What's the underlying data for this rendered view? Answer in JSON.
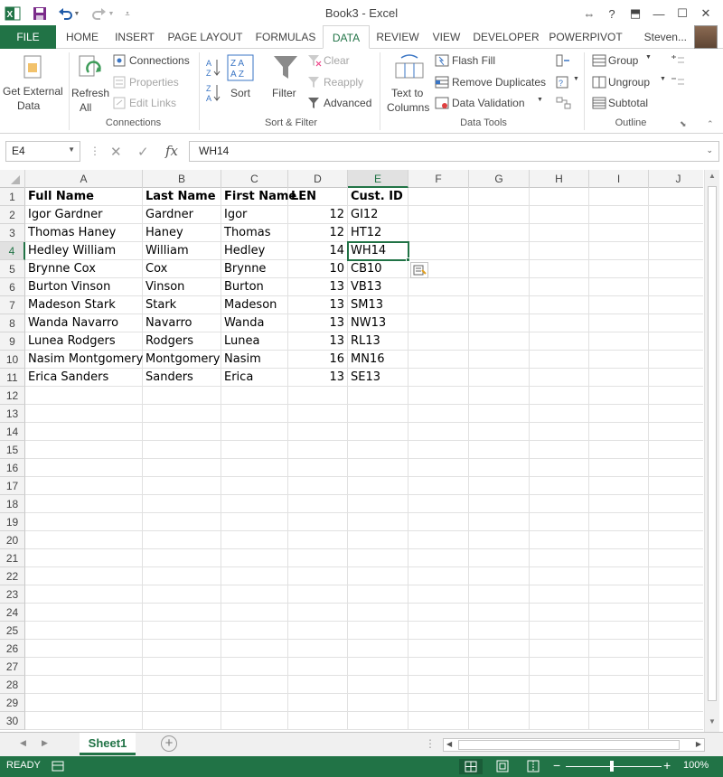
{
  "window": {
    "title": "Book3 - Excel",
    "help": "?",
    "restore_ribbon": "⬒",
    "minimize": "—",
    "maximize": "☐",
    "close": "✕"
  },
  "quick_access": {
    "more": "⇔"
  },
  "tabs": {
    "file": "FILE",
    "home": "HOME",
    "insert": "INSERT",
    "page_layout": "PAGE LAYOUT",
    "formulas": "FORMULAS",
    "data": "DATA",
    "review": "REVIEW",
    "view": "VIEW",
    "developer": "DEVELOPER",
    "powerpivot": "POWERPIVOT",
    "user": "Steven..."
  },
  "ribbon": {
    "get_external_1": "Get External",
    "get_external_2": "Data",
    "refresh_1": "Refresh",
    "refresh_2": "All",
    "connections": "Connections",
    "properties": "Properties",
    "edit_links": "Edit Links",
    "group_connections": "Connections",
    "sort": "Sort",
    "filter": "Filter",
    "clear": "Clear",
    "reapply": "Reapply",
    "advanced": "Advanced",
    "group_sort_filter": "Sort & Filter",
    "text_to_1": "Text to",
    "text_to_2": "Columns",
    "flash_fill": "Flash Fill",
    "remove_duplicates": "Remove Duplicates",
    "data_validation": "Data Validation",
    "group_data_tools": "Data Tools",
    "group": "Group",
    "ungroup": "Ungroup",
    "subtotal": "Subtotal",
    "group_outline": "Outline"
  },
  "formula_bar": {
    "name_box": "E4",
    "cancel": "✕",
    "enter": "✓",
    "fx": "fx",
    "value": "WH14"
  },
  "columns": [
    "A",
    "B",
    "C",
    "D",
    "E",
    "F",
    "G",
    "H",
    "I",
    "J"
  ],
  "selected_cell": "E4",
  "rows": [
    {
      "n": "1",
      "a": "Full Name",
      "b": "Last Name",
      "c": "First Name",
      "d": "LEN",
      "e": "Cust. ID"
    },
    {
      "n": "2",
      "a": "Igor Gardner",
      "b": "Gardner",
      "c": "Igor",
      "d": "12",
      "e": "GI12"
    },
    {
      "n": "3",
      "a": "Thomas Haney",
      "b": "Haney",
      "c": "Thomas",
      "d": "12",
      "e": "HT12"
    },
    {
      "n": "4",
      "a": "Hedley William",
      "b": "William",
      "c": "Hedley",
      "d": "14",
      "e": "WH14"
    },
    {
      "n": "5",
      "a": "Brynne Cox",
      "b": "Cox",
      "c": "Brynne",
      "d": "10",
      "e": "CB10"
    },
    {
      "n": "6",
      "a": "Burton Vinson",
      "b": "Vinson",
      "c": "Burton",
      "d": "13",
      "e": "VB13"
    },
    {
      "n": "7",
      "a": "Madeson Stark",
      "b": "Stark",
      "c": "Madeson",
      "d": "13",
      "e": "SM13"
    },
    {
      "n": "8",
      "a": "Wanda Navarro",
      "b": "Navarro",
      "c": "Wanda",
      "d": "13",
      "e": "NW13"
    },
    {
      "n": "9",
      "a": "Lunea Rodgers",
      "b": "Rodgers",
      "c": "Lunea",
      "d": "13",
      "e": "RL13"
    },
    {
      "n": "10",
      "a": "Nasim Montgomery",
      "b": "Montgomery",
      "c": "Nasim",
      "d": "16",
      "e": "MN16"
    },
    {
      "n": "11",
      "a": "Erica Sanders",
      "b": "Sanders",
      "c": "Erica",
      "d": "13",
      "e": "SE13"
    },
    {
      "n": "12"
    },
    {
      "n": "13"
    },
    {
      "n": "14"
    },
    {
      "n": "15"
    },
    {
      "n": "16"
    },
    {
      "n": "17"
    },
    {
      "n": "18"
    },
    {
      "n": "19"
    },
    {
      "n": "20"
    },
    {
      "n": "21"
    },
    {
      "n": "22"
    },
    {
      "n": "23"
    },
    {
      "n": "24"
    },
    {
      "n": "25"
    },
    {
      "n": "26"
    },
    {
      "n": "27"
    },
    {
      "n": "28"
    },
    {
      "n": "29"
    },
    {
      "n": "30"
    }
  ],
  "sheets": {
    "active": "Sheet1",
    "add": "+"
  },
  "status": {
    "ready": "READY",
    "zoom": "100%"
  },
  "colors": {
    "accent": "#217346"
  }
}
